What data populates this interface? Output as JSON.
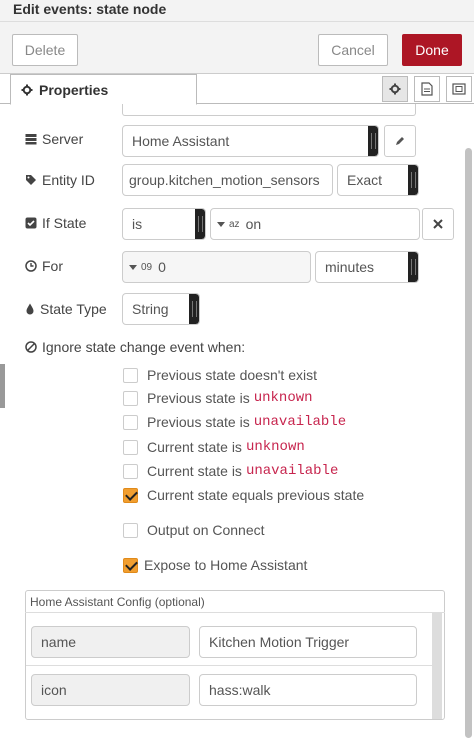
{
  "window": {
    "title": "Edit events: state node"
  },
  "actions": {
    "delete": "Delete",
    "cancel": "Cancel",
    "done": "Done"
  },
  "tabs": {
    "properties": "Properties"
  },
  "server": {
    "label": "Server",
    "value": "Home Assistant"
  },
  "entity": {
    "label": "Entity ID",
    "value": "group.kitchen_motion_sensors",
    "match": "Exact"
  },
  "if_state": {
    "label": "If State",
    "operator": "is",
    "type_badge": "az",
    "value": "on"
  },
  "for": {
    "label": "For",
    "type_badge": "09",
    "value": "0",
    "units": "minutes"
  },
  "state_type": {
    "label": "State Type",
    "value": "String"
  },
  "ignore": {
    "label": "Ignore state change event when:",
    "options": [
      {
        "text": "Previous state doesn't exist",
        "code": "",
        "checked": false
      },
      {
        "text": "Previous state is",
        "code": "unknown",
        "checked": false
      },
      {
        "text": "Previous state is",
        "code": "unavailable",
        "checked": false
      },
      {
        "text": "Current state is",
        "code": "unknown",
        "checked": false
      },
      {
        "text": "Current state is",
        "code": "unavailable",
        "checked": false
      },
      {
        "text": "Current state equals previous state",
        "code": "",
        "checked": true
      }
    ]
  },
  "output_on_connect": {
    "label": "Output on Connect",
    "checked": false
  },
  "expose": {
    "label": "Expose to Home Assistant",
    "checked": true
  },
  "ha_config": {
    "title": "Home Assistant Config (optional)",
    "rows": [
      {
        "key": "name",
        "value": "Kitchen Motion Trigger"
      },
      {
        "key": "icon",
        "value": "hass:walk"
      }
    ]
  },
  "colors": {
    "done": "#ad1625",
    "checkbox": "#f19e2f",
    "code_text": "#c7254e"
  }
}
